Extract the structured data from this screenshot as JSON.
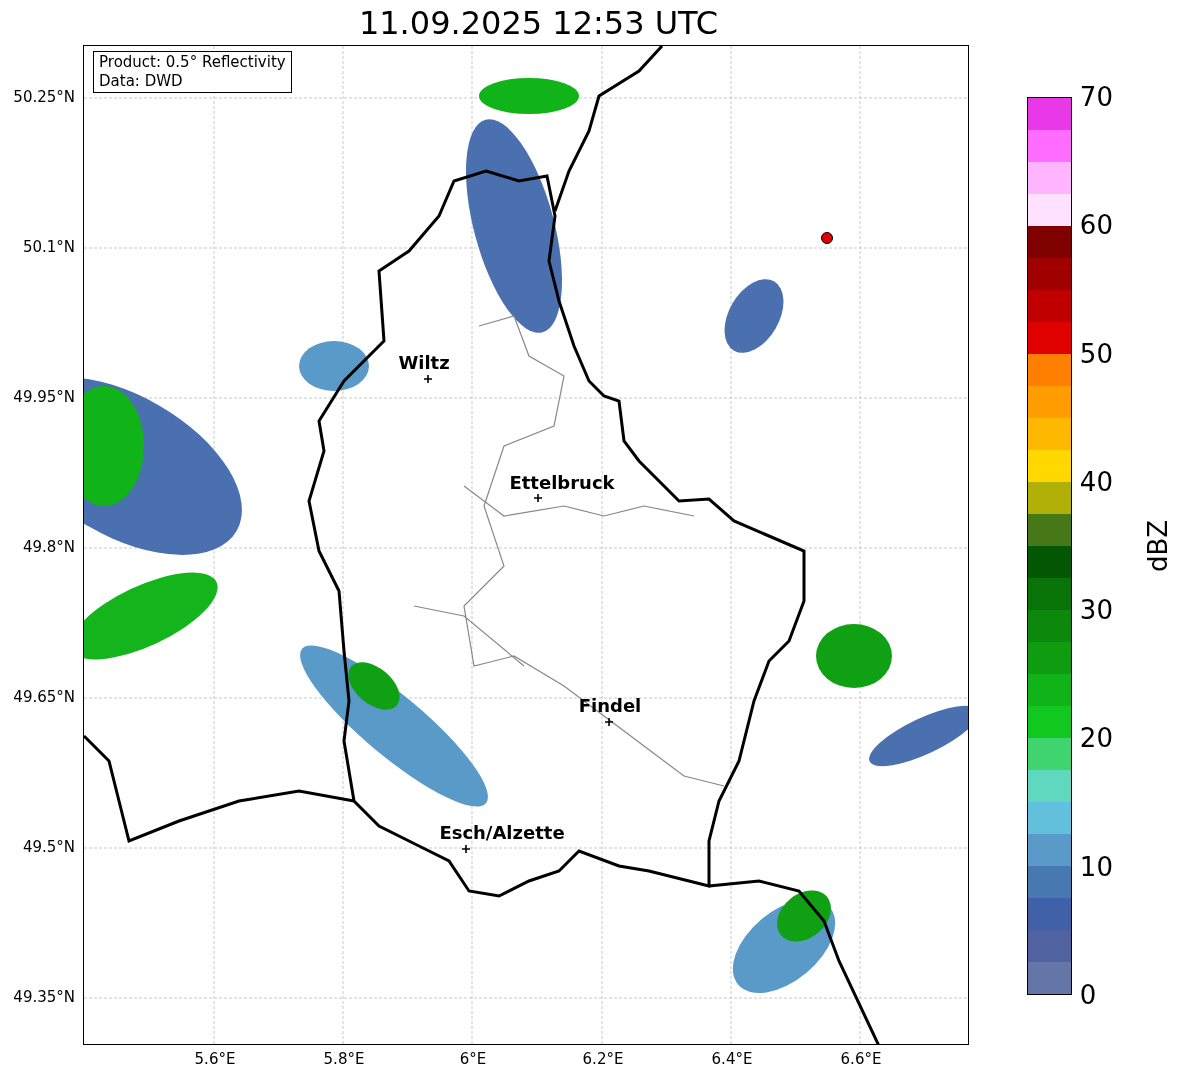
{
  "title": "11.09.2025 12:53 UTC",
  "info_box": [
    "Product: 0.5° Reflectivity",
    "Data: DWD"
  ],
  "y_ticks": [
    "50.25°N",
    "50.1°N",
    "49.95°N",
    "49.8°N",
    "49.65°N",
    "49.5°N",
    "49.35°N"
  ],
  "x_ticks": [
    "5.6°E",
    "5.8°E",
    "6°E",
    "6.2°E",
    "6.4°E",
    "6.6°E"
  ],
  "cities": [
    {
      "name": "Wiltz"
    },
    {
      "name": "Ettelbruck"
    },
    {
      "name": "Findel"
    },
    {
      "name": "Esch/Alzette"
    }
  ],
  "colorbar": {
    "label": "dBZ",
    "ticks": [
      "70",
      "60",
      "50",
      "40",
      "30",
      "20",
      "10",
      "0"
    ],
    "segments": [
      {
        "color": "#e838e8"
      },
      {
        "color": "#ff6cff"
      },
      {
        "color": "#ffb4ff"
      },
      {
        "color": "#ffe0ff"
      },
      {
        "color": "#800000"
      },
      {
        "color": "#a00000"
      },
      {
        "color": "#c00000"
      },
      {
        "color": "#e00000"
      },
      {
        "color": "#ff8000"
      },
      {
        "color": "#ff9c00"
      },
      {
        "color": "#ffb800"
      },
      {
        "color": "#ffd800"
      },
      {
        "color": "#b0b008"
      },
      {
        "color": "#467818"
      },
      {
        "color": "#045804"
      },
      {
        "color": "#087408"
      },
      {
        "color": "#0c880c"
      },
      {
        "color": "#109c10"
      },
      {
        "color": "#10b418"
      },
      {
        "color": "#10c820"
      },
      {
        "color": "#40d470"
      },
      {
        "color": "#60d8c0"
      },
      {
        "color": "#62c0dc"
      },
      {
        "color": "#5a9ac8"
      },
      {
        "color": "#4878b0"
      },
      {
        "color": "#4060a8"
      },
      {
        "color": "#5062a0"
      },
      {
        "color": "#6476a8"
      }
    ]
  }
}
